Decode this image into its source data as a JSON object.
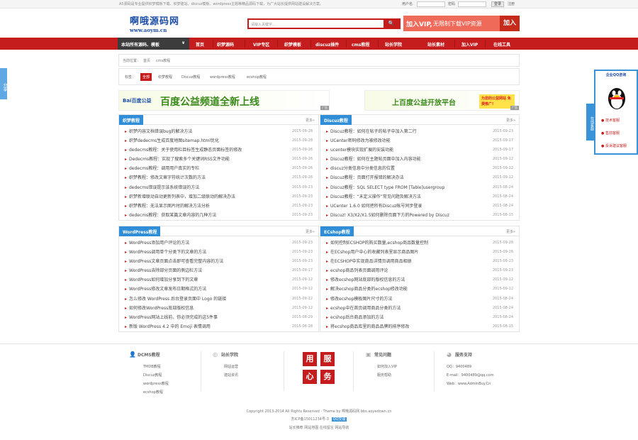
{
  "topbar": {
    "notice": "A5源码是专业提供织梦模板下载、织梦建站、discuz模板、wordpress主题等精品源码下载，为广大站长提供网站建设解决方案。",
    "user_label": "用户名",
    "pass_label": "密码",
    "login": "登录",
    "register": "注册"
  },
  "logo": {
    "cn": "啊哦源码网",
    "en": "www.aoym.cn"
  },
  "search": {
    "placeholder": "请输入关键字...",
    "button": "🔍"
  },
  "vip_ad": {
    "t1": "加入VIP,",
    "t2": "无限制下载VIP资源",
    "t3": "加入"
  },
  "nav": {
    "category": "本站所有源码、模板",
    "items": [
      "首页",
      "织梦源码",
      "VIP专区",
      "织梦模板",
      "discuz插件",
      "cms教程",
      "站长学院",
      "站长素材",
      "加入VIP",
      "在线工具"
    ]
  },
  "breadcrumb": [
    "当前位置：",
    "首页",
    "cms教程"
  ],
  "tags": {
    "label": "标签：",
    "items": [
      "全部",
      "织梦教程",
      "Discuz教程",
      "wordpress教程",
      "ecshop教程"
    ]
  },
  "banners": [
    {
      "logo": "Bai百度公益",
      "text": "百度公益频道全新上线",
      "ad": "广告"
    },
    {
      "text": "上百度公益开放平台",
      "promo": "为您的公益网站 免费推广!",
      "ad": "广告"
    }
  ],
  "boxes": [
    {
      "title": "织梦教程",
      "more": "更多»",
      "items": [
        [
          "织梦内容文档错误bug的解决方法",
          "2015-09-28"
        ],
        [
          "织梦dedecms生成百度地图sitemap.html优化",
          "2015-09-28"
        ],
        [
          "dedecms教程：关于使用栏目标签生成静态页面标签的修改",
          "2015-09-26"
        ],
        [
          "Dedecms教程：实现了搜索多个关键词RSS文件功能",
          "2015-09-26"
        ],
        [
          "dedecms教程：调用用户真实的专栏",
          "2015-09-26"
        ],
        [
          "织梦教程：修改文章字符统计次数的方法",
          "2015-09-26"
        ],
        [
          "dedecms错误提示该系统错误的方法",
          "2015-09-23"
        ],
        [
          "织梦新增联动自动更新列表中，增加二级联动的解决办法",
          "2015-09-23"
        ],
        [
          "织梦教程：无法显示图片时的解决方法分析",
          "2015-09-23"
        ],
        [
          "dedecms教程：获取某篇文章内容的几种方法",
          "2015-09-23"
        ]
      ]
    },
    {
      "title": "Discuz教程",
      "more": "更多»",
      "items": [
        [
          "Discuz教程：如何在帖子的帖子中加入第二行",
          "2015-09-23"
        ],
        [
          "UCenter密码修改为被修改功能",
          "2015-09-17"
        ],
        [
          "ucenter模块实现扩展的安装功能",
          "2015-09-17"
        ],
        [
          "Discuz教程：如何在主题帖页面中加入内容功能",
          "2015-09-12"
        ],
        [
          "discuz分类信息中分类信息的位置",
          "2015-09-12"
        ],
        [
          "Discuz教程：页面打开报错的解决办法",
          "2015-09-12"
        ],
        [
          "Discuz教程：SQL SELECT type FROM [Table]usergroup",
          "2015-08-24"
        ],
        [
          "Discuz教程：“未定义操作”常见问题及解决方法",
          "2015-08-24"
        ],
        [
          "UCenter 1.6.0 如何把所有Discuz帐号同步登录",
          "2015-08-24"
        ],
        [
          "Discuz! X3/X2/X1.5如何删除页面下方的Powered by Discuz",
          "2015-08-15"
        ]
      ]
    },
    {
      "title": "WordPress教程",
      "more": "更多»",
      "items": [
        [
          "WordPress添加用户评论的方法",
          "2015-09-23"
        ],
        [
          "WordPress调用单个分类下的文章的方法",
          "2015-09-23"
        ],
        [
          "WordPress文章页面点击即可查看完整内容的方法",
          "2015-09-23"
        ],
        [
          "WordPress去除部分页面的侧边栏方法",
          "2015-09-17"
        ],
        [
          "WordPress如何增加分享到下的文章",
          "2015-09-12"
        ],
        [
          "WordPress修改文章发布日期格式的方法",
          "2015-09-12"
        ],
        [
          "怎么修改 WordPress 后台登录页面中 Logo 的链接",
          "2015-09-12"
        ],
        [
          "如何修改WordPress底部版权信息",
          "2015-09-12"
        ],
        [
          "WordPress网站上线前，你必须完成的这5件事",
          "2015-08-29"
        ],
        [
          "新版 WordPress 4.2 中的 Emoji 表情调用",
          "2015-08-28"
        ]
      ]
    },
    {
      "title": "ECshop教程",
      "more": "更多»",
      "items": [
        [
          "如何控制ECSHOP的购买数量,ecshop商品数量控制",
          "2015-09-28"
        ],
        [
          "在ECshop用户中心的收藏列表里显示商品图片",
          "2015-09-26"
        ],
        [
          "在ECSHOP中实现商品详情页调用商品相册",
          "2015-09-23"
        ],
        [
          "ecshop商品列表页面调用评论",
          "2015-09-23"
        ],
        [
          "修改ecshop网站底部的版权信息的方法",
          "2015-09-12"
        ],
        [
          "解决ecshop商品分类的ecshop修改功能",
          "2015-09-12"
        ],
        [
          "修改ecshop模板图片尺寸的方法",
          "2015-08-24"
        ],
        [
          "ecshop中在首页调用商品分类的方法",
          "2015-08-24"
        ],
        [
          "ecshop后台商品添加的方法",
          "2015-08-24"
        ],
        [
          "将ecshop商品库里的商品品牌的排序修改",
          "2015-08-15"
        ]
      ]
    }
  ],
  "share_tab": "分享",
  "qq_panel": {
    "title": "企业QQ咨询",
    "rows": [
      "技术客服",
      "售前客服",
      "投诉建议客服"
    ],
    "side": "在线客服"
  },
  "footer": {
    "cols": [
      {
        "title": "DCMS教程",
        "links": [
          "TMDB教程",
          "Discuz教程",
          "wordpress教程",
          "ecshop教程"
        ]
      },
      {
        "title": "站长学院",
        "links": [
          "网站运营",
          "建站资讯"
        ]
      },
      {
        "title": "常见问题",
        "links": [
          "如何加入VIP",
          "服务帮助"
        ]
      },
      {
        "title": "服务支持",
        "links": [
          "QQ：9400489",
          "E-mail：9400489@qq.com",
          "Web：www.AdminBuy.Cn"
        ]
      }
    ],
    "seal": [
      "用",
      "服",
      "心",
      "务"
    ],
    "copyright": "Copyright 2013-2014 All Rights Reserved · Theme by 啊哦源码网 bbs.aoyedown.cn",
    "icp": "苏ICP备15011234号-3",
    "qq_badge": "QQ交谈",
    "links": "站长推荐 网站地图 在线留言 网站导航"
  }
}
